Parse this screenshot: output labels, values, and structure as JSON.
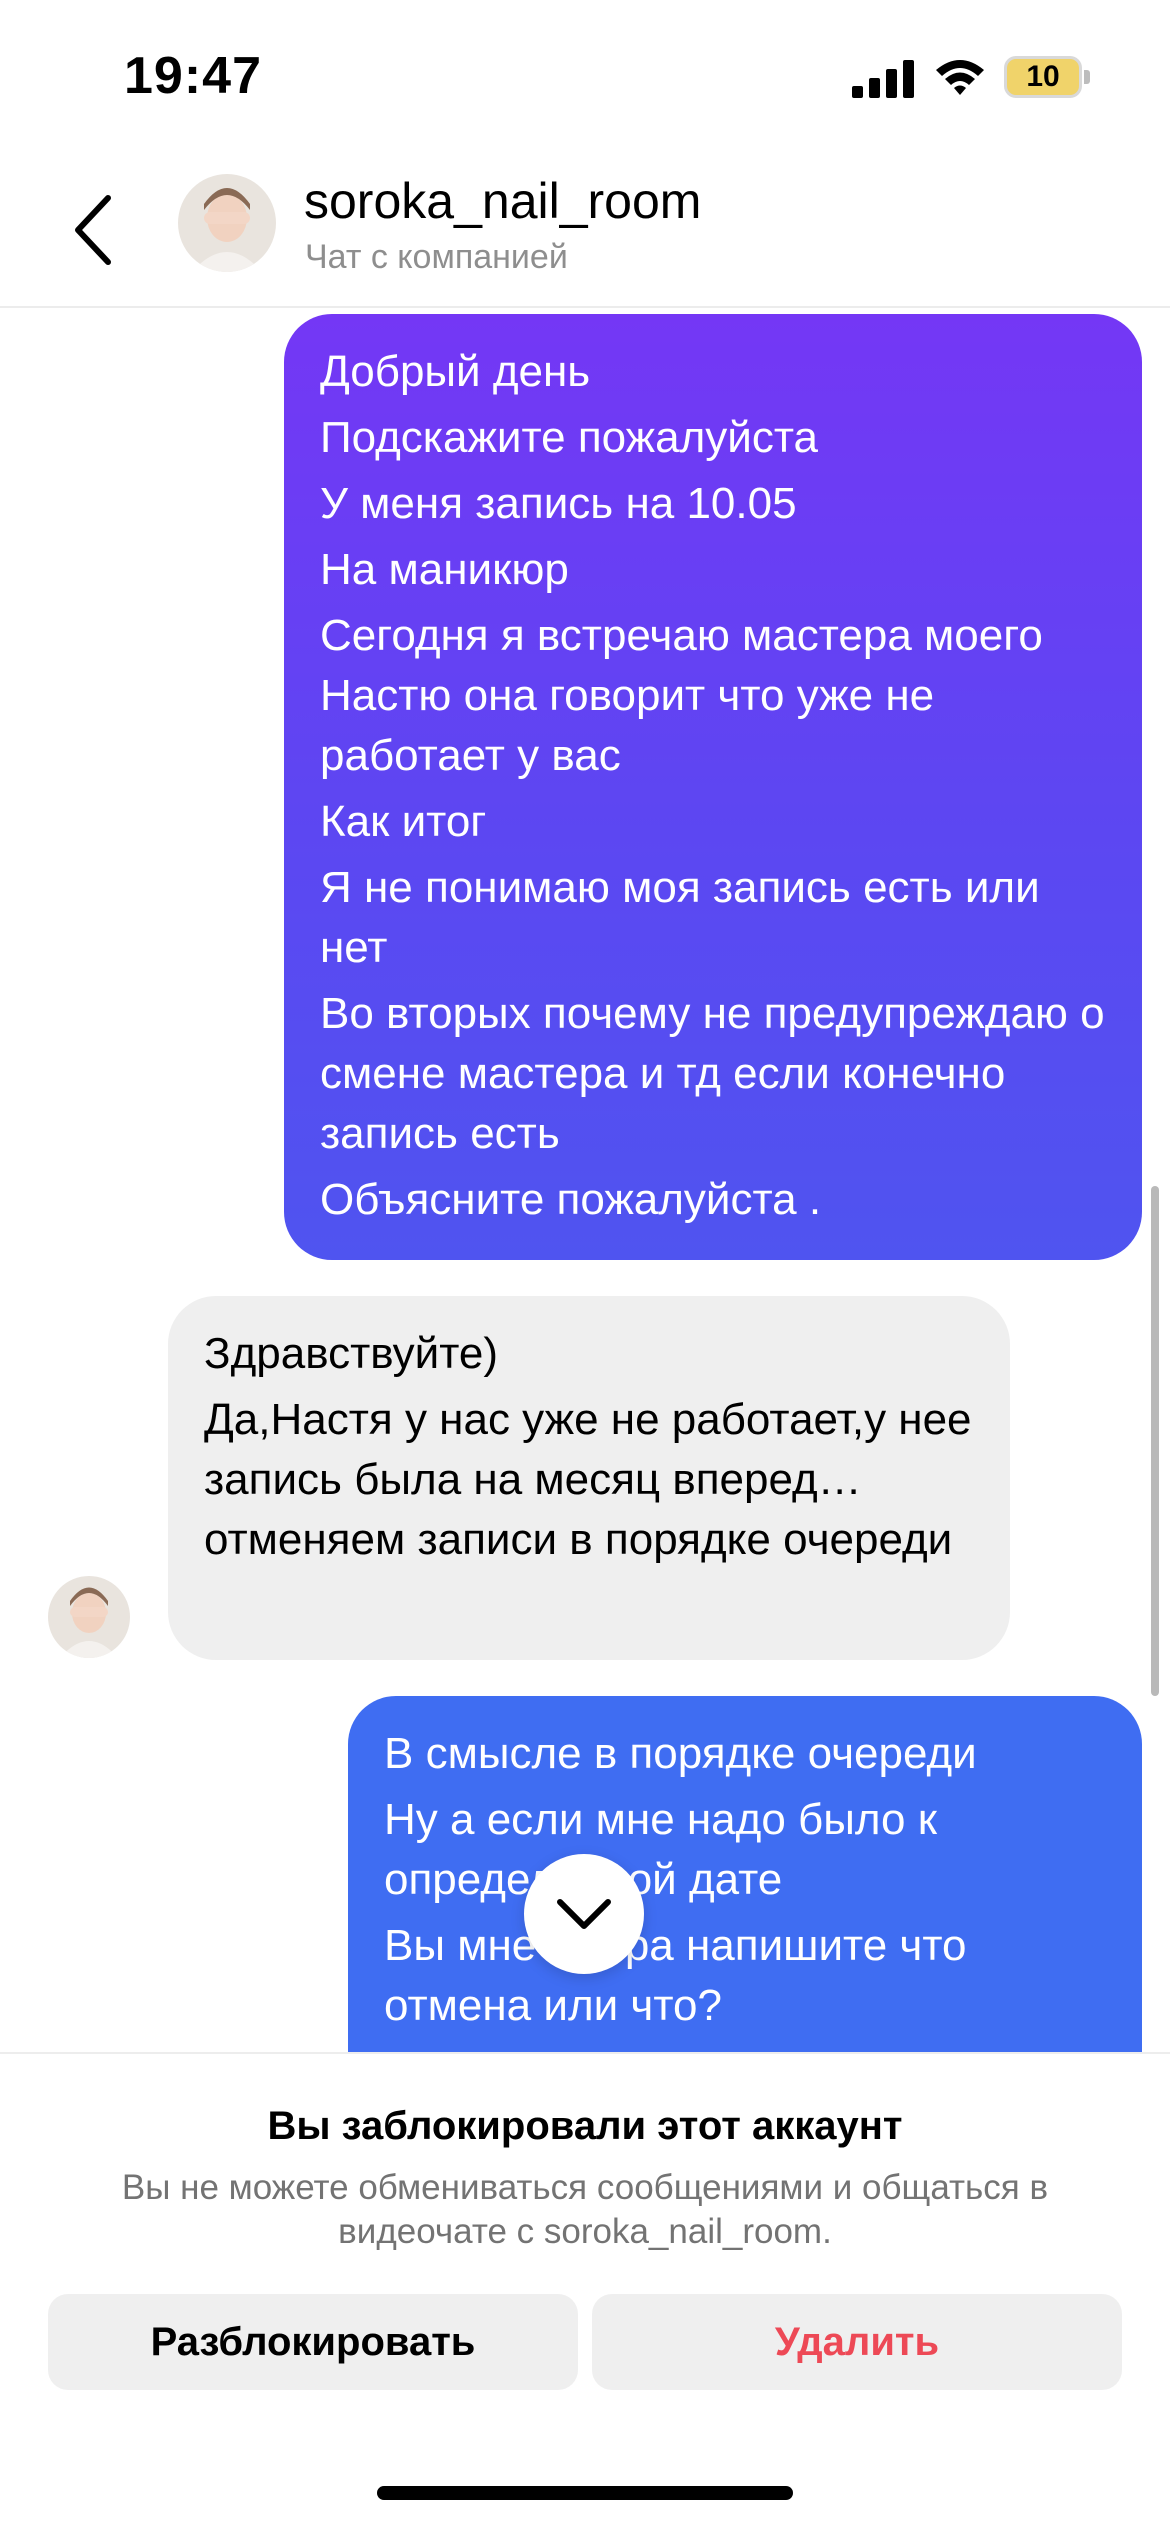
{
  "status_bar": {
    "time": "19:47",
    "battery_text": "10",
    "icons": [
      "signal-icon",
      "wifi-icon",
      "battery-icon"
    ]
  },
  "header": {
    "title": "soroka_nail_room",
    "subtitle": "Чат с компанией",
    "back_icon": "chevron-left-icon"
  },
  "messages": [
    {
      "direction": "outgoing",
      "lines": [
        "Добрый день",
        "Подскажите пожалуйста",
        "У меня запись на 10.05",
        "На маникюр",
        "Сегодня я встречаю мастера моего Настю она говорит что уже не работает у вас",
        "Как итог",
        "Я не понимаю моя запись есть или нет",
        "Во вторых почему не предупреждаю о смене мастера и тд если конечно запись есть",
        "Объясните пожалуйста ."
      ]
    },
    {
      "direction": "incoming",
      "lines": [
        "Здравствуйте)",
        "Да,Настя у нас уже не работает,у нее запись была на месяц вперед…отменяем записи в порядке очереди"
      ]
    },
    {
      "direction": "outgoing",
      "lines": [
        "В смысле в порядке очереди",
        "Ну а если мне надо было к определенной дате",
        "Вы мне с утра напишите что отмена или что?"
      ]
    }
  ],
  "blocked": {
    "title": "Вы заблокировали этот аккаунт",
    "description": "Вы не можете обмениваться сообщениями и общаться в видеочате с soroka_nail_room.",
    "unblock_label": "Разблокировать",
    "delete_label": "Удалить"
  },
  "colors": {
    "outgoing_gradient_top": "#7437f5",
    "outgoing_gradient_bottom": "#4f54f0",
    "outgoing_solid": "#3f6df2",
    "incoming_bg": "#efefef",
    "delete_red": "#ed4956"
  }
}
